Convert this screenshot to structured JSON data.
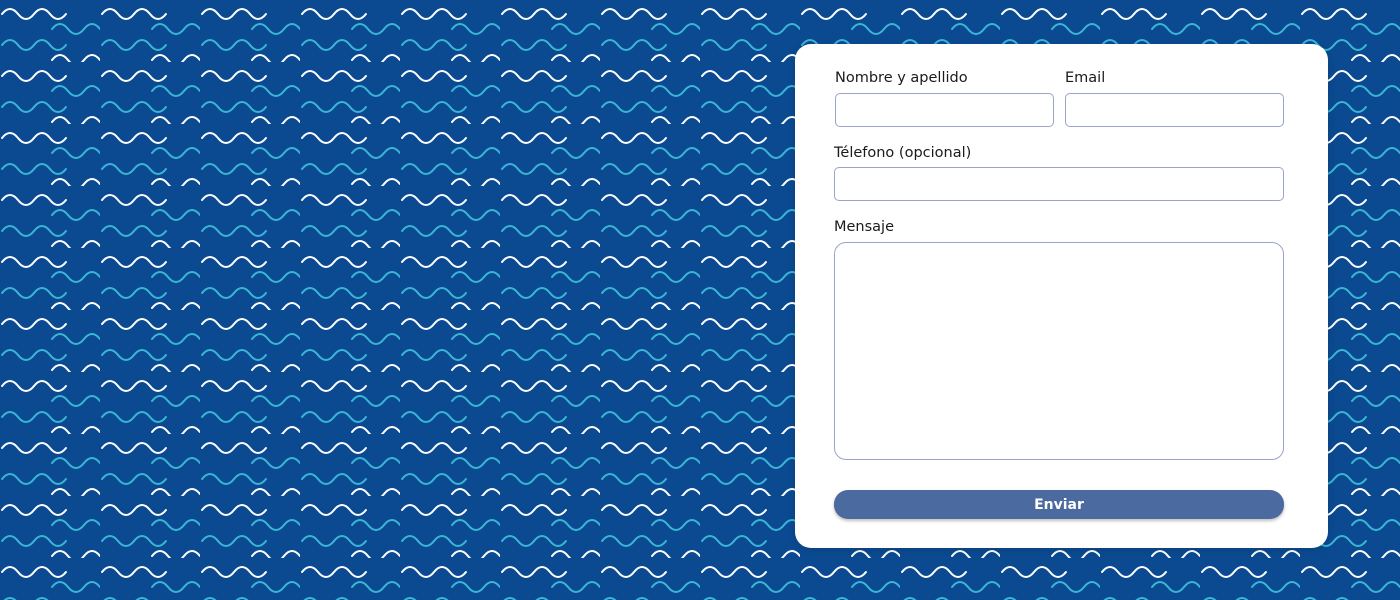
{
  "theme": {
    "background": "#0b4a91",
    "wave_white": "#ffffff",
    "wave_cyan": "#39b6d6",
    "button": "#4a6aa0",
    "field_border": "#9aa3c9"
  },
  "form": {
    "name_label": "Nombre y apellido",
    "name_value": "",
    "email_label": "Email",
    "email_value": "",
    "phone_label": "Télefono (opcional)",
    "phone_value": "",
    "message_label": "Mensaje",
    "message_value": "",
    "submit_label": "Enviar"
  }
}
